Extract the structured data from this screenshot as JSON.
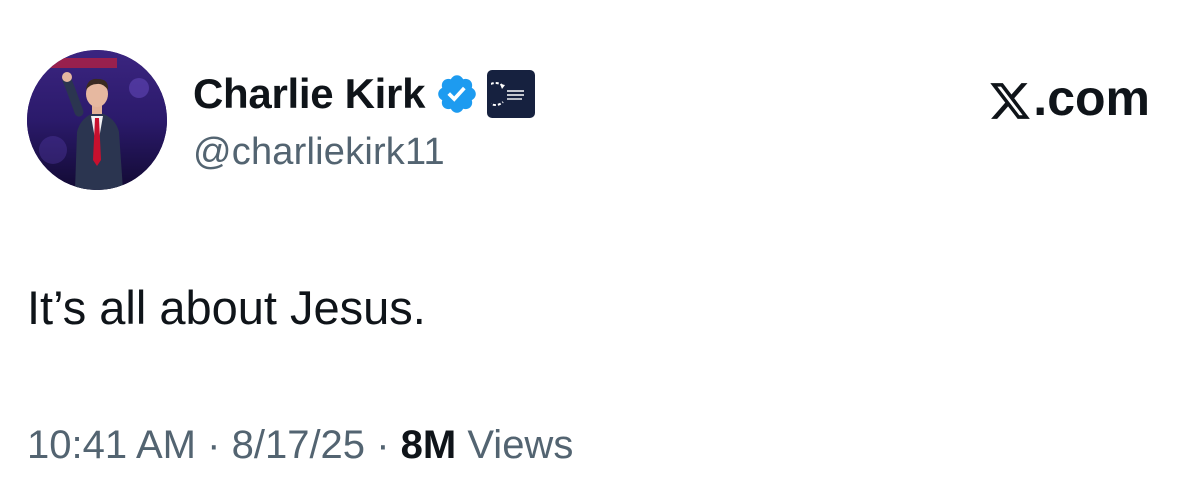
{
  "author": {
    "display_name": "Charlie Kirk",
    "handle": "@charliekirk11",
    "verified_icon": "verified-checkmark-icon",
    "affiliate_badge_text": "TURNING POINT USA"
  },
  "site": {
    "label": ".com",
    "logo_icon": "x-logo-icon"
  },
  "tweet": {
    "text": "It’s all about Jesus."
  },
  "meta": {
    "time": "10:41 AM",
    "separator": "·",
    "date": "8/17/25",
    "views_count": "8M",
    "views_label": "Views"
  },
  "colors": {
    "verified_blue": "#1d9bf0",
    "text_primary": "#0f1419",
    "text_secondary": "#536471",
    "affiliate_bg": "#16213f"
  }
}
